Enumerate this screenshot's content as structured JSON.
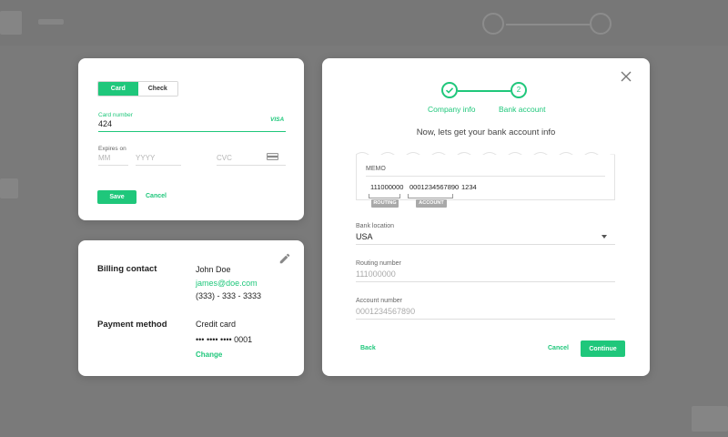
{
  "card_form": {
    "tabs": [
      "Card",
      "Check"
    ],
    "active_tab": "Card",
    "card_number_label": "Card number",
    "card_number_value": "424",
    "card_brand": "VISA",
    "expires_label": "Expires on",
    "month_placeholder": "MM",
    "year_placeholder": "YYYY",
    "cvc_placeholder": "CVC",
    "save_label": "Save",
    "cancel_label": "Cancel"
  },
  "summary": {
    "billing_label": "Billing contact",
    "name": "John Doe",
    "email": "james@doe.com",
    "phone": "(333) - 333 - 3333",
    "payment_label": "Payment method",
    "method": "Credit card",
    "masked_number": "••• •••• •••• 0001",
    "change_label": "Change"
  },
  "bank_modal": {
    "steps": [
      {
        "label": "Company info",
        "number": "",
        "state": "done"
      },
      {
        "label": "Bank account",
        "number": "2",
        "state": "current"
      }
    ],
    "heading": "Now, lets get your bank account info",
    "check": {
      "memo": "MEMO",
      "routing": "111000000",
      "account": "0001234567890",
      "check_number": "1234",
      "routing_tag": "ROUTING",
      "account_tag": "ACCOUNT"
    },
    "bank_location_label": "Bank location",
    "bank_location_value": "USA",
    "routing_label": "Routing number",
    "routing_placeholder": "111000000",
    "account_label": "Account number",
    "account_placeholder": "0001234567890",
    "back_label": "Back",
    "cancel_label": "Cancel",
    "continue_label": "Continue"
  },
  "colors": {
    "accent": "#1fc77b",
    "overlay": "#7a7a7a"
  }
}
